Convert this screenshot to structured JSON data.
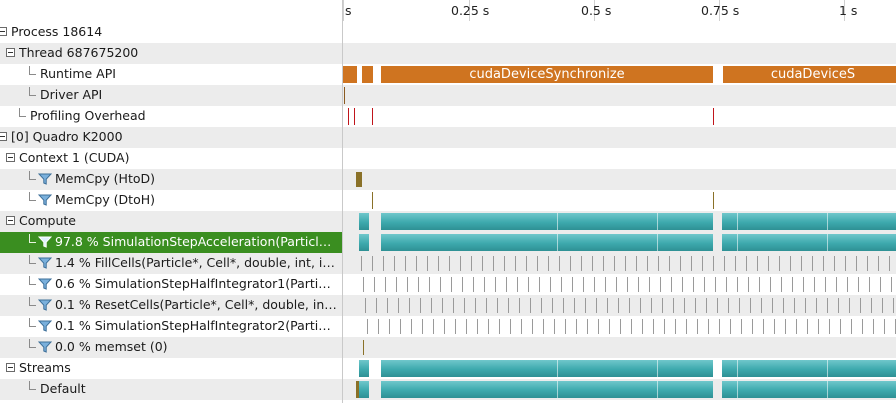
{
  "timeline": {
    "ticks": [
      "s",
      "0.25 s",
      "0.5 s",
      "0.75 s",
      "1 s"
    ]
  },
  "tree": [
    {
      "label": "Process 18614",
      "expander": true
    },
    {
      "label": "Thread 687675200",
      "expander": true
    },
    {
      "label": "Runtime API",
      "expander": false
    },
    {
      "label": "Driver API",
      "expander": false
    },
    {
      "label": "Profiling Overhead",
      "expander": false
    },
    {
      "label": "[0] Quadro K2000",
      "expander": true
    },
    {
      "label": "Context 1 (CUDA)",
      "expander": true
    },
    {
      "label": "MemCpy (HtoD)",
      "expander": false,
      "filter": true
    },
    {
      "label": "MemCpy (DtoH)",
      "expander": false,
      "filter": true
    },
    {
      "label": "Compute",
      "expander": true
    },
    {
      "label": "97.8 % SimulationStepAcceleration(Particl…",
      "expander": false,
      "filter": true,
      "selected": true
    },
    {
      "label": "1.4 % FillCells(Particle*, Cell*, double, int, i…",
      "expander": false,
      "filter": true
    },
    {
      "label": "0.6 % SimulationStepHalfIntegrator1(Parti…",
      "expander": false,
      "filter": true
    },
    {
      "label": "0.1 % ResetCells(Particle*, Cell*, double, in…",
      "expander": false,
      "filter": true
    },
    {
      "label": "0.1 % SimulationStepHalfIntegrator2(Parti…",
      "expander": false,
      "filter": true
    },
    {
      "label": "0.0 % memset (0)",
      "expander": false,
      "filter": true
    },
    {
      "label": "Streams",
      "expander": true
    },
    {
      "label": "Default",
      "expander": false
    }
  ],
  "runtime_api": {
    "bar_label_1": "cudaDeviceSynchronize",
    "bar_label_2": "cudaDeviceS"
  },
  "colors": {
    "runtime": "#cf7420",
    "kernel": "#3da9ad",
    "memcpy": "#8a7128",
    "overhead": "#c0151b",
    "selection": "#3a8e20"
  }
}
